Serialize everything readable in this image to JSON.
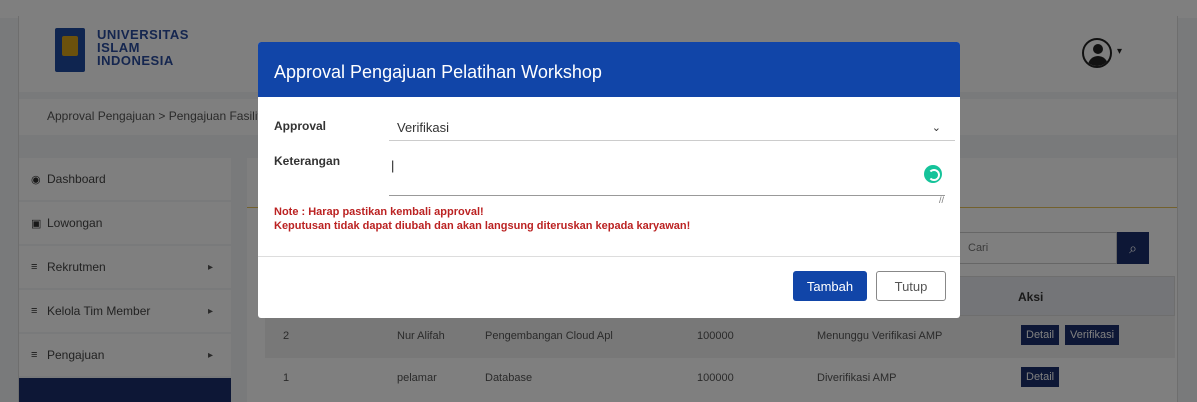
{
  "header": {
    "logo_lines": [
      "UNIVERSITAS",
      "ISLAM",
      "INDONESIA"
    ]
  },
  "breadcrumb": "Approval Pengajuan  >  Pengajuan Fasilitas",
  "sidebar": {
    "items": [
      {
        "label": "Dashboard",
        "icon": "dashboard-icon"
      },
      {
        "label": "Lowongan",
        "icon": "briefcase-icon"
      },
      {
        "label": "Rekrutmen",
        "icon": "list-icon"
      },
      {
        "label": "Kelola Tim Member",
        "icon": "list-icon"
      },
      {
        "label": "Pengajuan",
        "icon": "list-icon"
      }
    ]
  },
  "search": {
    "placeholder": "Cari"
  },
  "table": {
    "header_aksi": "Aksi",
    "rows": [
      {
        "no": "2",
        "nama": "Nur Alifah",
        "judul": "Pengembangan Cloud Apl",
        "biaya": "100000",
        "status": "Menunggu Verifikasi AMP",
        "actions": [
          "Detail",
          "Verifikasi"
        ]
      },
      {
        "no": "1",
        "nama": "pelamar",
        "judul": "Database",
        "biaya": "100000",
        "status": "Diverifikasi AMP",
        "actions": [
          "Detail"
        ]
      }
    ]
  },
  "modal": {
    "title": "Approval Pengajuan Pelatihan Workshop",
    "approval_label": "Approval",
    "approval_value": "Verifikasi",
    "keterangan_label": "Keterangan",
    "keterangan_value": "",
    "note_line1": "Note : Harap pastikan kembali approval!",
    "note_line2": "Keputusan tidak dapat diubah dan akan langsung diteruskan kepada karyawan!",
    "submit_label": "Tambah",
    "close_label": "Tutup"
  },
  "colors": {
    "primary": "#1145a8",
    "sidebar_active": "#1a2e6c",
    "note": "#b22222"
  }
}
